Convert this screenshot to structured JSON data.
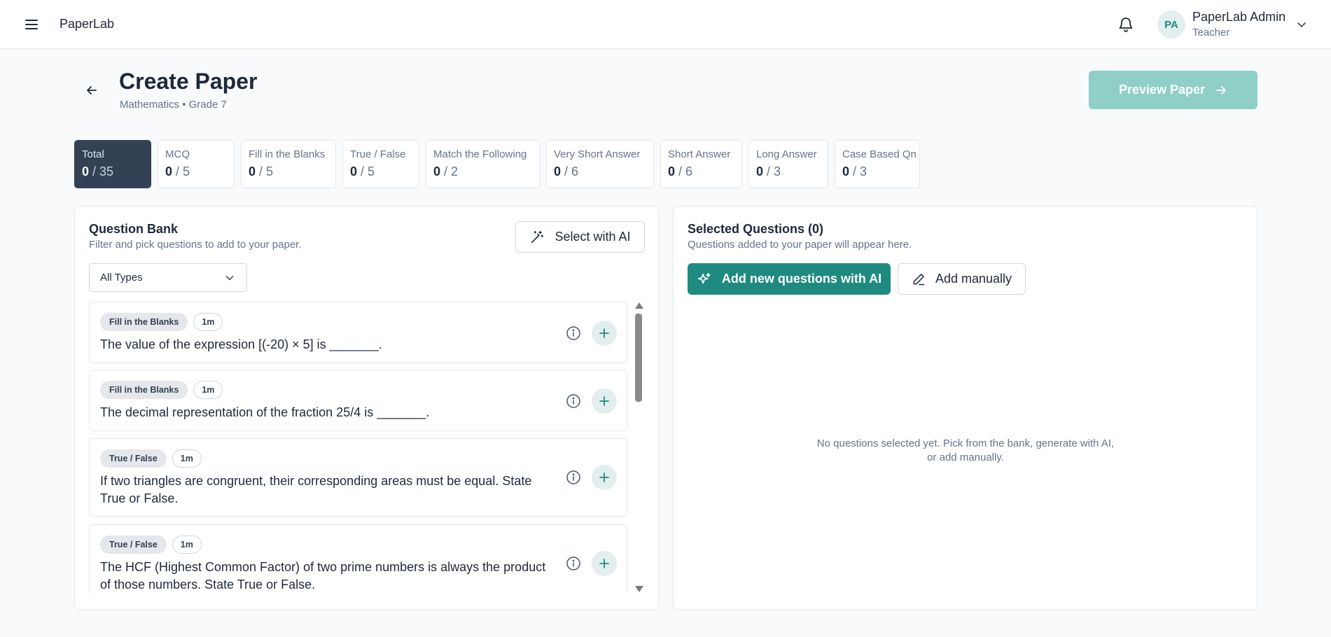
{
  "topbar": {
    "brand": "PaperLab",
    "avatar_initials": "PA",
    "user_name": "PaperLab Admin",
    "user_role": "Teacher"
  },
  "header": {
    "title": "Create Paper",
    "subtitle": "Mathematics • Grade 7",
    "preview_label": "Preview Paper"
  },
  "stats": [
    {
      "label": "Total",
      "value": "0",
      "max": "/ 35"
    },
    {
      "label": "MCQ",
      "value": "0",
      "max": "/ 5"
    },
    {
      "label": "Fill in the Blanks",
      "value": "0",
      "max": "/ 5"
    },
    {
      "label": "True / False",
      "value": "0",
      "max": "/ 5"
    },
    {
      "label": "Match the Following",
      "value": "0",
      "max": "/ 2"
    },
    {
      "label": "Very Short Answer",
      "value": "0",
      "max": "/ 6"
    },
    {
      "label": "Short Answer",
      "value": "0",
      "max": "/ 6"
    },
    {
      "label": "Long Answer",
      "value": "0",
      "max": "/ 3"
    },
    {
      "label": "Case Based Qn",
      "value": "0",
      "max": "/ 3"
    }
  ],
  "bank": {
    "title": "Question Bank",
    "description": "Filter and pick questions to add to your paper.",
    "ai_select_label": "Select with AI",
    "filter_value": "All Types",
    "questions": [
      {
        "type": "Fill in the Blanks",
        "marks": "1m",
        "text": "The value of the expression [(-20) × 5] is _______."
      },
      {
        "type": "Fill in the Blanks",
        "marks": "1m",
        "text": "The decimal representation of the fraction 25/4 is _______."
      },
      {
        "type": "True / False",
        "marks": "1m",
        "text": "If two triangles are congruent, their corresponding areas must be equal. State True or False."
      },
      {
        "type": "True / False",
        "marks": "1m",
        "text": "The HCF (Highest Common Factor) of two prime numbers is always the product of those numbers. State True or False."
      }
    ]
  },
  "selected": {
    "title": "Selected Questions (0)",
    "description": "Questions added to your paper will appear here.",
    "ai_add_label": "Add new questions with AI",
    "manual_label": "Add manually",
    "empty_message": "No questions selected yet. Pick from the bank, generate with AI, or add manually."
  },
  "colors": {
    "accent": "#1f8a80",
    "accent_disabled": "#8fcfc7",
    "active_chip": "#334155"
  },
  "icons": [
    "menu-icon",
    "bell-icon",
    "chevron-down-icon",
    "arrow-left-icon",
    "arrow-right-icon",
    "magic-wand-icon",
    "sparkles-icon",
    "pencil-icon",
    "info-icon",
    "plus-icon"
  ]
}
